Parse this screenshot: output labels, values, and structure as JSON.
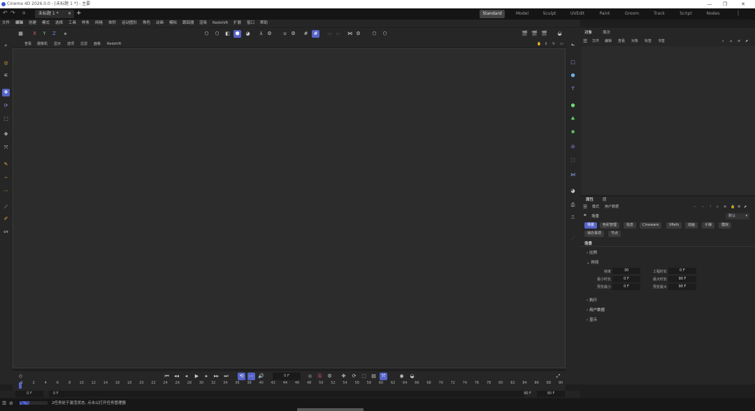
{
  "window": {
    "title": "Cinema 4D 2026.0.0 - [未标题 1 *] - 主要",
    "controls": [
      "—",
      "❐",
      "✕"
    ]
  },
  "tabs": {
    "doc": "未标题 1 *",
    "add": "+"
  },
  "layouts": [
    {
      "label": "Standard",
      "active": true
    },
    {
      "label": "Model"
    },
    {
      "label": "Sculpt"
    },
    {
      "label": "UVEdit"
    },
    {
      "label": "Paint"
    },
    {
      "label": "Groom"
    },
    {
      "label": "Track"
    },
    {
      "label": "Script"
    },
    {
      "label": "Nodes"
    }
  ],
  "menu": [
    "文件",
    "编辑",
    "创建",
    "模式",
    "选择",
    "工具",
    "样条",
    "网格",
    "体积",
    "运动图形",
    "角色",
    "动画",
    "模拟",
    "跟踪器",
    "渲染",
    "Redshift",
    "扩展",
    "窗口",
    "帮助"
  ],
  "axes": [
    "X",
    "Y",
    "Z"
  ],
  "viewport_menu": [
    "查看",
    "摄像机",
    "显示",
    "选项",
    "过滤",
    "面板",
    "Redshift"
  ],
  "object_manager": {
    "tabs": [
      "对象",
      "场次"
    ],
    "menu": [
      "文件",
      "编辑",
      "查看",
      "对象",
      "标签",
      "书签"
    ]
  },
  "attributes": {
    "tabs": [
      "属性",
      "层"
    ],
    "menu": [
      "模式",
      "用户数据"
    ],
    "context": "场景",
    "preset": "默认",
    "scene_tabs": [
      {
        "label": "场景",
        "active": true
      },
      {
        "label": "色彩管理"
      },
      {
        "label": "信息"
      },
      {
        "label": "Cineware"
      },
      {
        "label": "XRefs"
      },
      {
        "label": "动画"
      },
      {
        "label": "子弹"
      },
      {
        "label": "模拟"
      },
      {
        "label": "待办事项"
      },
      {
        "label": "节点"
      }
    ],
    "section_title": "场景",
    "groups": [
      "比例",
      "时间",
      "执行",
      "用户数据",
      "显示"
    ],
    "time_fields": [
      {
        "label": "帧率",
        "value": "30",
        "label2": "工程时长",
        "value2": "0 F"
      },
      {
        "label": "最小时长",
        "value": "0 F",
        "label2": "最大时长",
        "value2": "90 F"
      },
      {
        "label": "预览最小",
        "value": "0 F",
        "label2": "预览最大",
        "value2": "90 F"
      }
    ]
  },
  "transport": {
    "current_frame": "0 F"
  },
  "timeline": {
    "ticks": [
      "0",
      "2",
      "4",
      "6",
      "8",
      "10",
      "12",
      "14",
      "16",
      "18",
      "20",
      "22",
      "24",
      "26",
      "28",
      "30",
      "32",
      "34",
      "36",
      "38",
      "40",
      "42",
      "44",
      "46",
      "48",
      "50",
      "52",
      "54",
      "56",
      "58",
      "60",
      "62",
      "64",
      "66",
      "68",
      "70",
      "72",
      "74",
      "76",
      "78",
      "80",
      "82",
      "84",
      "86",
      "88",
      "90"
    ],
    "start": "0 F",
    "start2": "0 F",
    "end": "90 F",
    "end2": "90 F"
  },
  "status": {
    "message": "2任务处于激活状态, 点击以打开任务管理器",
    "progress": 0.35
  }
}
